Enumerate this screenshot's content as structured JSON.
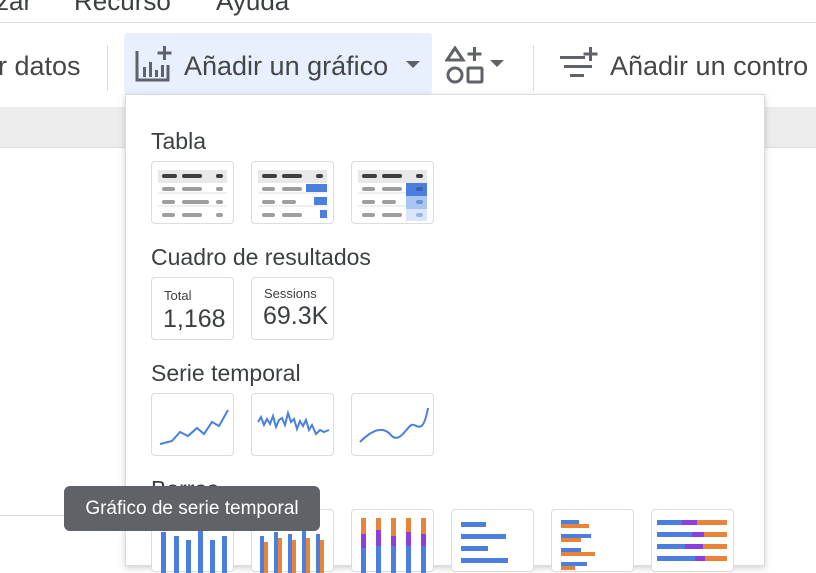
{
  "menubar": {
    "items": [
      "zar",
      "Recurso",
      "Ayuda"
    ]
  },
  "toolbar": {
    "data_label": "r datos",
    "add_chart_label": "Añadir un gráfico",
    "add_control_label": "Añadir un contro"
  },
  "chart_menu": {
    "sections": {
      "table": "Tabla",
      "scorecard": "Cuadro de resultados",
      "timeseries": "Serie temporal",
      "bar": "Barras"
    },
    "scorecards": [
      {
        "label": "Total",
        "value": "1,168"
      },
      {
        "label": "Sessions",
        "value": "69.3K"
      }
    ]
  },
  "tooltip": {
    "text": "Gráfico de serie temporal"
  },
  "colors": {
    "accent": "#4a7fe0",
    "orange": "#e8833a",
    "purple": "#8b3fdc",
    "bar_gray": "#9e9e9e",
    "header_gray": "#3c4043"
  }
}
